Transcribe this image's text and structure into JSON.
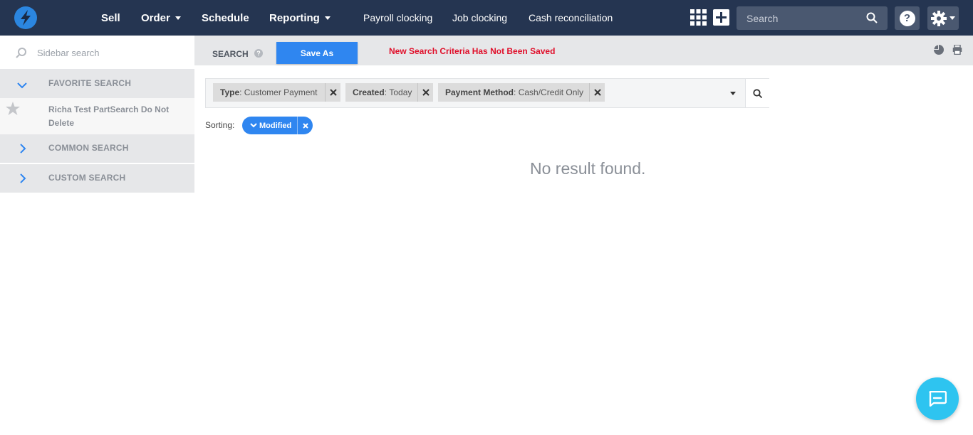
{
  "topbar": {
    "nav": [
      {
        "label": "Sell",
        "has_caret": false
      },
      {
        "label": "Order",
        "has_caret": true
      },
      {
        "label": "Schedule",
        "has_caret": false
      },
      {
        "label": "Reporting",
        "has_caret": true
      }
    ],
    "subnav": [
      "Payroll clocking",
      "Job clocking",
      "Cash reconciliation"
    ],
    "search_placeholder": "Search",
    "icons": [
      "logo-bolt-icon",
      "apps-grid-icon",
      "plus-icon",
      "search-icon",
      "help-icon",
      "gear-icon"
    ]
  },
  "sidebar": {
    "search_placeholder": "Sidebar search",
    "sections": [
      {
        "title": "FAVORITE SEARCH",
        "expanded": true,
        "items": [
          "Richa Test PartSearch Do Not Delete"
        ]
      },
      {
        "title": "COMMON SEARCH",
        "expanded": false
      },
      {
        "title": "CUSTOM SEARCH",
        "expanded": false
      }
    ]
  },
  "toolbar": {
    "label": "SEARCH",
    "help": "?",
    "save_as": "Save As",
    "warning": "New Search Criteria Has Not Been Saved"
  },
  "filters": [
    {
      "key": "Type",
      "value": "Customer Payment"
    },
    {
      "key": "Created",
      "value": "Today"
    },
    {
      "key": "Payment Method",
      "value": "Cash/Credit Only"
    }
  ],
  "sorting": {
    "label": "Sorting:",
    "value": "Modified"
  },
  "results": {
    "empty_message": "No result found."
  },
  "colors": {
    "topbar": "#253551",
    "accent": "#2f86f0",
    "warning": "#e0102b",
    "chat": "#2ec4f0"
  }
}
